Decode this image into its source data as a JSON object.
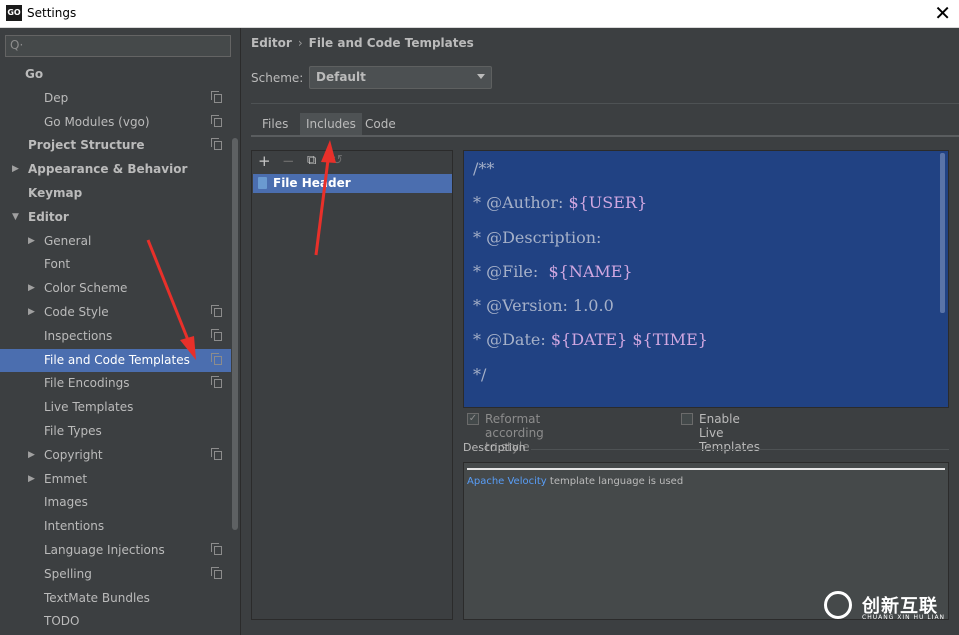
{
  "window": {
    "app_icon_text": "GO",
    "title": "Settings"
  },
  "search": {
    "placeholder": "Q·"
  },
  "sidebar": {
    "items": [
      {
        "label": "Go",
        "level": 0,
        "bold": true,
        "arrow": "",
        "copy": false,
        "selected": false
      },
      {
        "label": "Dep",
        "level": 1,
        "bold": false,
        "arrow": "",
        "copy": true,
        "selected": false
      },
      {
        "label": "Go Modules (vgo)",
        "level": 1,
        "bold": false,
        "arrow": "",
        "copy": true,
        "selected": false
      },
      {
        "label": "Project Structure",
        "level": 0,
        "bold": true,
        "arrow": "",
        "copy": true,
        "selected": false
      },
      {
        "label": "Appearance & Behavior",
        "level": 0,
        "bold": true,
        "arrow": "right",
        "copy": false,
        "selected": false
      },
      {
        "label": "Keymap",
        "level": 0,
        "bold": true,
        "arrow": "",
        "copy": false,
        "selected": false
      },
      {
        "label": "Editor",
        "level": 0,
        "bold": true,
        "arrow": "down",
        "copy": false,
        "selected": false
      },
      {
        "label": "General",
        "level": 1,
        "bold": false,
        "arrow": "right",
        "copy": false,
        "selected": false
      },
      {
        "label": "Font",
        "level": 1,
        "bold": false,
        "arrow": "",
        "copy": false,
        "selected": false
      },
      {
        "label": "Color Scheme",
        "level": 1,
        "bold": false,
        "arrow": "right",
        "copy": false,
        "selected": false
      },
      {
        "label": "Code Style",
        "level": 1,
        "bold": false,
        "arrow": "right",
        "copy": true,
        "selected": false
      },
      {
        "label": "Inspections",
        "level": 1,
        "bold": false,
        "arrow": "",
        "copy": true,
        "selected": false
      },
      {
        "label": "File and Code Templates",
        "level": 1,
        "bold": false,
        "arrow": "",
        "copy": true,
        "selected": true
      },
      {
        "label": "File Encodings",
        "level": 1,
        "bold": false,
        "arrow": "",
        "copy": true,
        "selected": false
      },
      {
        "label": "Live Templates",
        "level": 1,
        "bold": false,
        "arrow": "",
        "copy": false,
        "selected": false
      },
      {
        "label": "File Types",
        "level": 1,
        "bold": false,
        "arrow": "",
        "copy": false,
        "selected": false
      },
      {
        "label": "Copyright",
        "level": 1,
        "bold": false,
        "arrow": "right",
        "copy": true,
        "selected": false
      },
      {
        "label": "Emmet",
        "level": 1,
        "bold": false,
        "arrow": "right",
        "copy": false,
        "selected": false
      },
      {
        "label": "Images",
        "level": 1,
        "bold": false,
        "arrow": "",
        "copy": false,
        "selected": false
      },
      {
        "label": "Intentions",
        "level": 1,
        "bold": false,
        "arrow": "",
        "copy": false,
        "selected": false
      },
      {
        "label": "Language Injections",
        "level": 1,
        "bold": false,
        "arrow": "",
        "copy": true,
        "selected": false
      },
      {
        "label": "Spelling",
        "level": 1,
        "bold": false,
        "arrow": "",
        "copy": true,
        "selected": false
      },
      {
        "label": "TextMate Bundles",
        "level": 1,
        "bold": false,
        "arrow": "",
        "copy": false,
        "selected": false
      },
      {
        "label": "TODO",
        "level": 1,
        "bold": false,
        "arrow": "",
        "copy": false,
        "selected": false
      }
    ]
  },
  "breadcrumb": {
    "parent": "Editor",
    "separator": "›",
    "current": "File and Code Templates"
  },
  "scheme": {
    "label": "Scheme:",
    "value": "Default"
  },
  "tabs": [
    {
      "label": "Files",
      "active": false
    },
    {
      "label": "Includes",
      "active": true
    },
    {
      "label": "Code",
      "active": false
    }
  ],
  "toolbar": {
    "add": "+",
    "remove": "−",
    "copy": "⧉",
    "reset": "↺"
  },
  "templates": [
    {
      "label": "File Header",
      "selected": true
    }
  ],
  "editor": {
    "lines": [
      [
        {
          "t": "/**",
          "c": "plain"
        }
      ],
      [
        {
          "t": "* @Author: ",
          "c": "plain"
        },
        {
          "t": "${USER}",
          "c": "var"
        }
      ],
      [
        {
          "t": "* @Description:",
          "c": "plain"
        }
      ],
      [
        {
          "t": "* @File:  ",
          "c": "plain"
        },
        {
          "t": "${NAME}",
          "c": "var"
        }
      ],
      [
        {
          "t": "* @Version: 1.0.0",
          "c": "plain"
        }
      ],
      [
        {
          "t": "* @Date: ",
          "c": "plain"
        },
        {
          "t": "${DATE}",
          "c": "var"
        },
        {
          "t": " ",
          "c": "plain"
        },
        {
          "t": "${TIME}",
          "c": "var"
        }
      ],
      [
        {
          "t": "*/",
          "c": "plain"
        }
      ]
    ]
  },
  "options": {
    "reformat": {
      "label": "Reformat according to style",
      "checked": true
    },
    "live_templates": {
      "label": "Enable Live Templates",
      "checked": false
    }
  },
  "description": {
    "label": "Description",
    "link": "Apache Velocity",
    "text": " template language is used"
  },
  "watermark": {
    "text": "创新互联",
    "sub": "CHUANG XIN HU LIAN"
  },
  "colors": {
    "background": "#3c3f41",
    "selection": "#4b6eaf",
    "editor_selection": "#214283",
    "link": "#589df6",
    "annotation_arrow": "#e8302a"
  }
}
